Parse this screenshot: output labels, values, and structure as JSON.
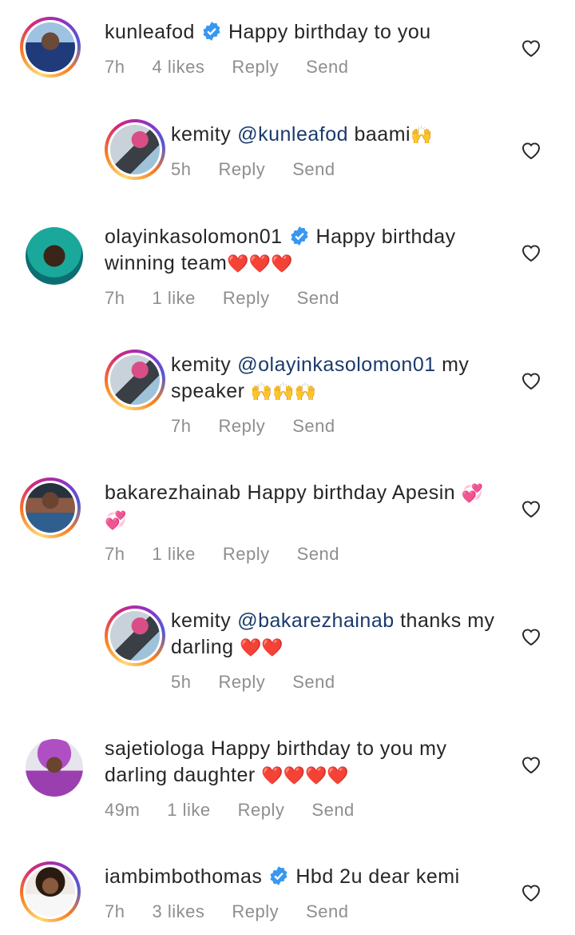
{
  "actions": {
    "reply": "Reply",
    "send": "Send"
  },
  "comments": [
    {
      "user": "kunleafod",
      "verified": true,
      "mention": "",
      "text": "Happy birthday to you",
      "emoji": "",
      "time": "7h",
      "likes": "4 likes"
    },
    {
      "user": "kemity",
      "verified": false,
      "mention": "@kunleafod",
      "text": "baami",
      "emoji": "🙌",
      "time": "5h",
      "likes": ""
    },
    {
      "user": "olayinkasolomon01",
      "verified": true,
      "mention": "",
      "text": "Happy birthday winning team",
      "emoji": "❤️❤️❤️",
      "time": "7h",
      "likes": "1 like"
    },
    {
      "user": "kemity",
      "verified": false,
      "mention": "@olayinkasolomon01",
      "text": "my speaker",
      "emoji": "🙌🙌🙌",
      "time": "7h",
      "likes": ""
    },
    {
      "user": "bakarezhainab",
      "verified": false,
      "mention": "",
      "text": "Happy birthday Apesin",
      "emoji": "💞💞",
      "time": "7h",
      "likes": "1 like"
    },
    {
      "user": "kemity",
      "verified": false,
      "mention": "@bakarezhainab",
      "text": "thanks my darling",
      "emoji": "❤️❤️",
      "time": "5h",
      "likes": ""
    },
    {
      "user": "sajetiologa",
      "verified": false,
      "mention": "",
      "text": "Happy birthday to you my darling daughter",
      "emoji": "❤️❤️❤️❤️",
      "time": "49m",
      "likes": "1 like"
    },
    {
      "user": "iambimbothomas",
      "verified": true,
      "mention": "",
      "text": "Hbd 2u dear kemi",
      "emoji": "",
      "time": "7h",
      "likes": "3 likes"
    }
  ],
  "colors": {
    "verified": "#3897f0",
    "mention": "#1a3a6b",
    "muted": "#8e8e8e",
    "heart_emoji": "#e0242e"
  }
}
